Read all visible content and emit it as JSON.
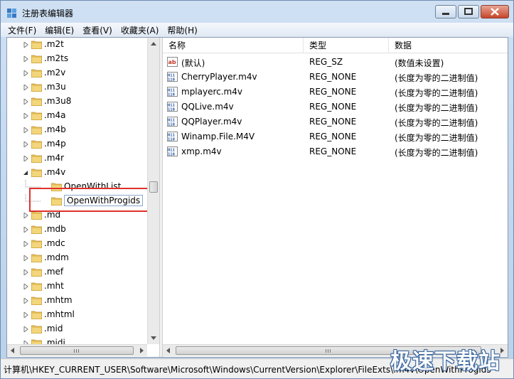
{
  "window": {
    "title": "注册表编辑器",
    "controls": [
      "minimize-icon",
      "maximize-icon",
      "close-icon"
    ]
  },
  "menu": [
    "文件(F)",
    "编辑(E)",
    "查看(V)",
    "收藏夹(A)",
    "帮助(H)"
  ],
  "tree": {
    "items": [
      {
        "label": ".m2t",
        "expander": "collapsed"
      },
      {
        "label": ".m2ts",
        "expander": "collapsed"
      },
      {
        "label": ".m2v",
        "expander": "collapsed"
      },
      {
        "label": ".m3u",
        "expander": "collapsed"
      },
      {
        "label": ".m3u8",
        "expander": "collapsed"
      },
      {
        "label": ".m4a",
        "expander": "collapsed"
      },
      {
        "label": ".m4b",
        "expander": "collapsed"
      },
      {
        "label": ".m4p",
        "expander": "collapsed"
      },
      {
        "label": ".m4r",
        "expander": "collapsed"
      },
      {
        "label": ".m4v",
        "expander": "expanded"
      },
      {
        "label": "OpenWithList",
        "child": true
      },
      {
        "label": "OpenWithProgids",
        "child": true,
        "selected": true
      },
      {
        "label": ".md",
        "expander": "collapsed"
      },
      {
        "label": ".mdb",
        "expander": "collapsed"
      },
      {
        "label": ".mdc",
        "expander": "collapsed"
      },
      {
        "label": ".mdm",
        "expander": "collapsed"
      },
      {
        "label": ".mef",
        "expander": "collapsed"
      },
      {
        "label": ".mht",
        "expander": "collapsed"
      },
      {
        "label": ".mhtm",
        "expander": "collapsed"
      },
      {
        "label": ".mhtml",
        "expander": "collapsed"
      },
      {
        "label": ".mid",
        "expander": "collapsed"
      },
      {
        "label": ".midi",
        "expander": "collapsed"
      }
    ]
  },
  "list": {
    "columns": [
      "名称",
      "类型",
      "数据"
    ],
    "rows": [
      {
        "name": "(默认)",
        "type": "REG_SZ",
        "data": "(数值未设置)",
        "icon": "string-value-icon"
      },
      {
        "name": "CherryPlayer.m4v",
        "type": "REG_NONE",
        "data": "(长度为零的二进制值)",
        "icon": "binary-value-icon"
      },
      {
        "name": "mplayerc.m4v",
        "type": "REG_NONE",
        "data": "(长度为零的二进制值)",
        "icon": "binary-value-icon"
      },
      {
        "name": "QQLive.m4v",
        "type": "REG_NONE",
        "data": "(长度为零的二进制值)",
        "icon": "binary-value-icon"
      },
      {
        "name": "QQPlayer.m4v",
        "type": "REG_NONE",
        "data": "(长度为零的二进制值)",
        "icon": "binary-value-icon"
      },
      {
        "name": "Winamp.File.M4V",
        "type": "REG_NONE",
        "data": "(长度为零的二进制值)",
        "icon": "binary-value-icon"
      },
      {
        "name": "xmp.m4v",
        "type": "REG_NONE",
        "data": "(长度为零的二进制值)",
        "icon": "binary-value-icon"
      }
    ]
  },
  "status": {
    "path": "计算机\\HKEY_CURRENT_USER\\Software\\Microsoft\\Windows\\CurrentVersion\\Explorer\\FileExts\\.m4v\\OpenWithProgids"
  },
  "watermark": "极速下载站",
  "colors": {
    "highlight": "#e0322a",
    "folder": "#e8c15a",
    "titlebar": "#c5d9f0"
  }
}
